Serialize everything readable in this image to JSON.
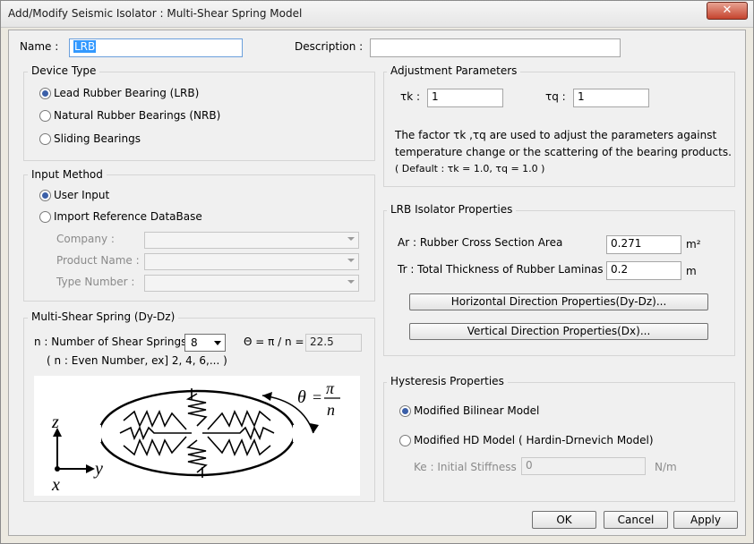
{
  "window": {
    "title": "Add/Modify Seismic Isolator : Multi-Shear Spring Model",
    "close": "✕"
  },
  "name_field": {
    "label": "Name :",
    "value": "LRB"
  },
  "description_field": {
    "label": "Description :",
    "value": ""
  },
  "device_type": {
    "title": "Device Type",
    "options": [
      "Lead Rubber Bearing (LRB)",
      "Natural Rubber Bearings (NRB)",
      "Sliding Bearings"
    ],
    "selected": 0
  },
  "input_method": {
    "title": "Input Method",
    "options": [
      "User Input",
      "Import Reference DataBase"
    ],
    "selected": 0,
    "company_label": "Company :",
    "product_label": "Product Name :",
    "type_label": "Type Number :"
  },
  "multi_shear": {
    "title": "Multi-Shear Spring (Dy-Dz)",
    "n_label": "n : Number of Shear Springs",
    "n_value": "8",
    "theta_label": "Θ = π / n =",
    "theta_value": "22.5",
    "note": "( n : Even Number, ex] 2, 4, 6,... )",
    "diagram": {
      "z": "z",
      "y": "y",
      "x": "x",
      "theta": "θ",
      "eq": "=",
      "pi": "π",
      "n": "n"
    }
  },
  "adjustment": {
    "title": "Adjustment Parameters",
    "tk_label": "τk :",
    "tk_value": "1",
    "tq_label": "τq :",
    "tq_value": "1",
    "desc1": "The factor τk ,τq are used to adjust the parameters against",
    "desc2": "temperature change or the scattering of the bearing products.",
    "desc3": "( Default : τk = 1.0, τq = 1.0 )"
  },
  "lrb": {
    "title": "LRB Isolator Properties",
    "ar_label": "Ar : Rubber Cross Section Area",
    "ar_value": "0.271",
    "ar_unit": "m²",
    "tr_label": "Tr : Total Thickness of Rubber Laminas",
    "tr_value": "0.2",
    "tr_unit": "m",
    "horizontal_button": "Horizontal Direction Properties(Dy-Dz)...",
    "vertical_button": "Vertical Direction Properties(Dx)..."
  },
  "hysteresis": {
    "title": "Hysteresis Properties",
    "options": [
      "Modified Bilinear Model",
      "Modified HD Model ( Hardin-Drnevich Model)"
    ],
    "selected": 0,
    "ke_label": "Ke : Initial Stiffness",
    "ke_value": "0",
    "ke_unit": "N/m"
  },
  "buttons": {
    "ok": "OK",
    "cancel": "Cancel",
    "apply": "Apply"
  }
}
